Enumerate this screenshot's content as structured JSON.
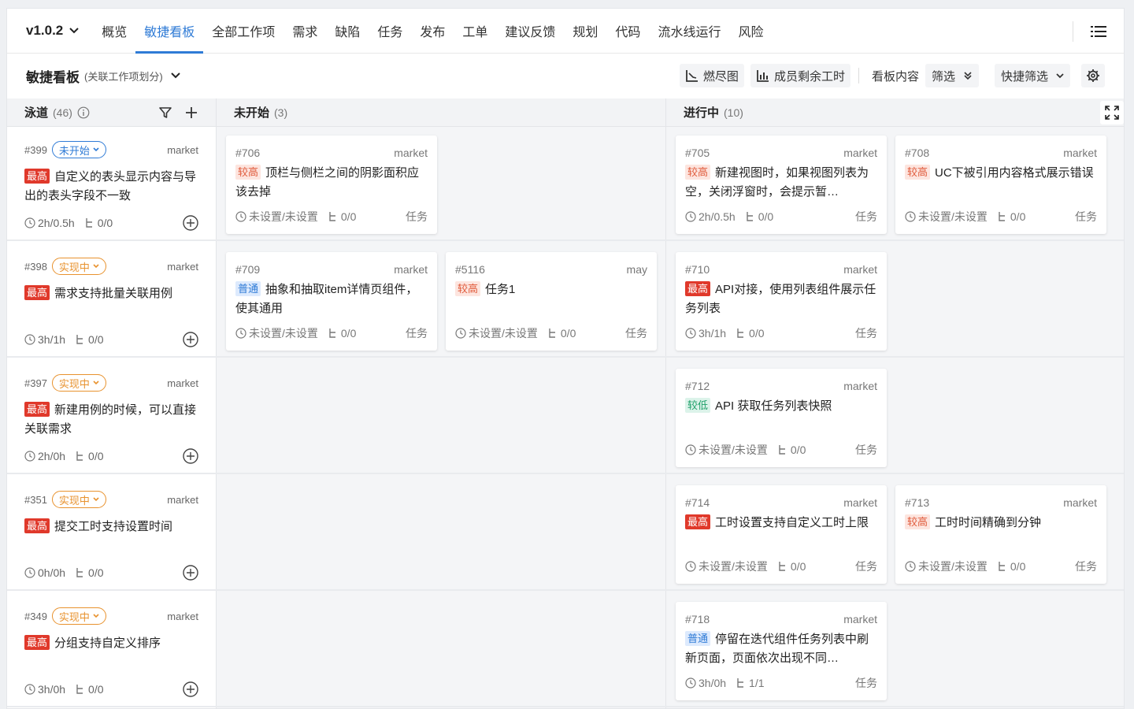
{
  "nav": {
    "version": "v1.0.2",
    "tabs": [
      "概览",
      "敏捷看板",
      "全部工作项",
      "需求",
      "缺陷",
      "任务",
      "发布",
      "工单",
      "建议反馈",
      "规划",
      "代码",
      "流水线运行",
      "风险"
    ],
    "active_tab": "敏捷看板"
  },
  "toolbar": {
    "title": "敏捷看板",
    "subtitle": "(关联工作项划分)",
    "burndown": "燃尽图",
    "member_hours": "成员剩余工时",
    "board_content": "看板内容",
    "filter": "筛选",
    "quick_filter": "快捷筛选"
  },
  "columns": {
    "lane": {
      "title": "泳道",
      "count": "(46)"
    },
    "todo": {
      "title": "未开始",
      "count": "(3)"
    },
    "doing": {
      "title": "进行中",
      "count": "(10)"
    }
  },
  "lanes": [
    {
      "id": "#399",
      "status": "未开始",
      "status_color": "blue",
      "owner": "market",
      "priority": "最高",
      "title": "自定义的表头显示内容与导出的表头字段不一致",
      "hours": "2h/0.5h",
      "sub": "0/0"
    },
    {
      "id": "#398",
      "status": "实现中",
      "status_color": "orange",
      "owner": "market",
      "priority": "最高",
      "title": "需求支持批量关联用例",
      "hours": "3h/1h",
      "sub": "0/0"
    },
    {
      "id": "#397",
      "status": "实现中",
      "status_color": "orange",
      "owner": "market",
      "priority": "最高",
      "title": "新建用例的时候，可以直接关联需求",
      "hours": "2h/0h",
      "sub": "0/0"
    },
    {
      "id": "#351",
      "status": "实现中",
      "status_color": "orange",
      "owner": "market",
      "priority": "最高",
      "title": "提交工时支持设置时间",
      "hours": "0h/0h",
      "sub": "0/0"
    },
    {
      "id": "#349",
      "status": "实现中",
      "status_color": "orange",
      "owner": "market",
      "priority": "最高",
      "title": "分组支持自定义排序",
      "hours": "3h/0h",
      "sub": "0/0"
    }
  ],
  "cards": [
    {
      "id": "#706",
      "owner": "market",
      "priority": "较高",
      "pclass": "mid",
      "title": "顶栏与侧栏之间的阴影面积应该去掉",
      "hours": "未设置/未设置",
      "sub": "0/0",
      "type": "任务"
    },
    {
      "id": "#705",
      "owner": "market",
      "priority": "较高",
      "pclass": "mid",
      "title": "新建视图时，如果视图列表为空，关闭浮窗时，会提示暂…",
      "hours": "2h/0.5h",
      "sub": "0/0",
      "type": "任务"
    },
    {
      "id": "#708",
      "owner": "market",
      "priority": "较高",
      "pclass": "mid",
      "title": "UC下被引用内容格式展示错误",
      "hours": "未设置/未设置",
      "sub": "0/0",
      "type": "任务"
    },
    {
      "id": "#709",
      "owner": "market",
      "priority": "普通",
      "pclass": "normal",
      "title": "抽象和抽取item详情页组件，使其通用",
      "hours": "未设置/未设置",
      "sub": "0/0",
      "type": "任务"
    },
    {
      "id": "#5116",
      "owner": "may",
      "priority": "较高",
      "pclass": "mid",
      "title": "任务1",
      "hours": "未设置/未设置",
      "sub": "0/0",
      "type": "任务"
    },
    {
      "id": "#710",
      "owner": "market",
      "priority": "最高",
      "pclass": "high",
      "title": "API对接，使用列表组件展示任务列表",
      "hours": "3h/1h",
      "sub": "0/0",
      "type": "任务"
    },
    {
      "id": "#712",
      "owner": "market",
      "priority": "较低",
      "pclass": "low",
      "title": "API 获取任务列表快照",
      "hours": "未设置/未设置",
      "sub": "0/0",
      "type": "任务"
    },
    {
      "id": "#714",
      "owner": "market",
      "priority": "最高",
      "pclass": "high",
      "title": "工时设置支持自定义工时上限",
      "hours": "未设置/未设置",
      "sub": "0/0",
      "type": "任务"
    },
    {
      "id": "#713",
      "owner": "market",
      "priority": "较高",
      "pclass": "mid",
      "title": "工时时间精确到分钟",
      "hours": "未设置/未设置",
      "sub": "0/0",
      "type": "任务"
    },
    {
      "id": "#718",
      "owner": "market",
      "priority": "普通",
      "pclass": "normal",
      "title": "停留在迭代组件任务列表中刷新页面，页面依次出现不同…",
      "hours": "3h/0h",
      "sub": "1/1",
      "type": "任务"
    }
  ],
  "colors": {
    "accent": "#2f7bd6",
    "high": "#e0392b",
    "orange": "#e8922e"
  }
}
